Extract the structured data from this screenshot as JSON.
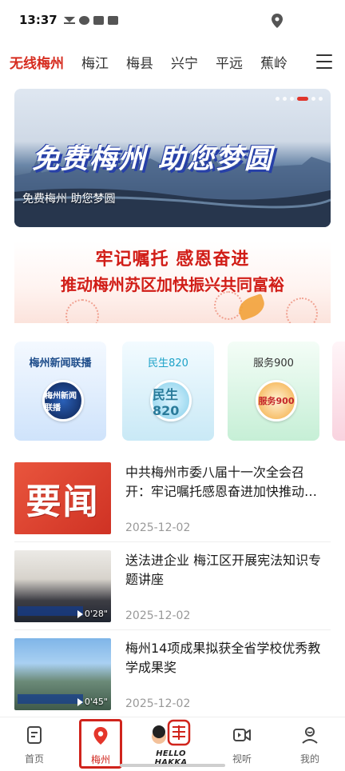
{
  "status_bar": {
    "time": "13:37",
    "icons": [
      "crown-icon",
      "swirl-icon",
      "media-icon",
      "message-icon"
    ],
    "right_icon": "location-pin-icon"
  },
  "tabs": {
    "items": [
      "无线梅州",
      "梅江",
      "梅县",
      "兴宁",
      "平远",
      "蕉岭"
    ],
    "active_index": 0,
    "menu_icon": "menu-icon"
  },
  "banner": {
    "slogan": "免费梅州 助您梦圆",
    "caption": "免费梅州 助您梦圆",
    "slide_count": 6,
    "active_slide": 4
  },
  "promo": {
    "line1": "牢记嘱托  感恩奋进",
    "line2": "推动梅州苏区加快振兴共同富裕"
  },
  "channels": [
    {
      "name": "梅州新闻联播",
      "logo_text": "梅州新闻联播"
    },
    {
      "name": "民生820",
      "logo_text": "民生820"
    },
    {
      "name": "服务900",
      "logo_text": "服务900"
    }
  ],
  "news": [
    {
      "title": "中共梅州市委八届十一次全会召开：牢记嘱托感恩奋进加快推动梅州苏区振兴",
      "date": "2025-12-02",
      "thumb_text": "要闻",
      "duration": ""
    },
    {
      "title": "送法进企业 梅江区开展宪法知识专题讲座",
      "date": "2025-12-02",
      "thumb_text": "",
      "duration": "0'28\""
    },
    {
      "title": "梅州14项成果拟获全省学校优秀教学成果奖",
      "date": "2025-12-02",
      "thumb_text": "",
      "duration": "0'45\""
    }
  ],
  "bottom_nav": {
    "items": [
      {
        "label": "首页",
        "icon": "home-doc-icon"
      },
      {
        "label": "梅州",
        "icon": "location-pin-icon"
      },
      {
        "label": "HELLO HAKKA",
        "icon": "hello-hakka-mascot-icon"
      },
      {
        "label": "视听",
        "icon": "video-icon"
      },
      {
        "label": "我的",
        "icon": "profile-icon"
      }
    ],
    "active_index": 1
  },
  "colors": {
    "accent": "#d62c1f",
    "text_primary": "#1a1a1a",
    "text_secondary": "#999999"
  }
}
